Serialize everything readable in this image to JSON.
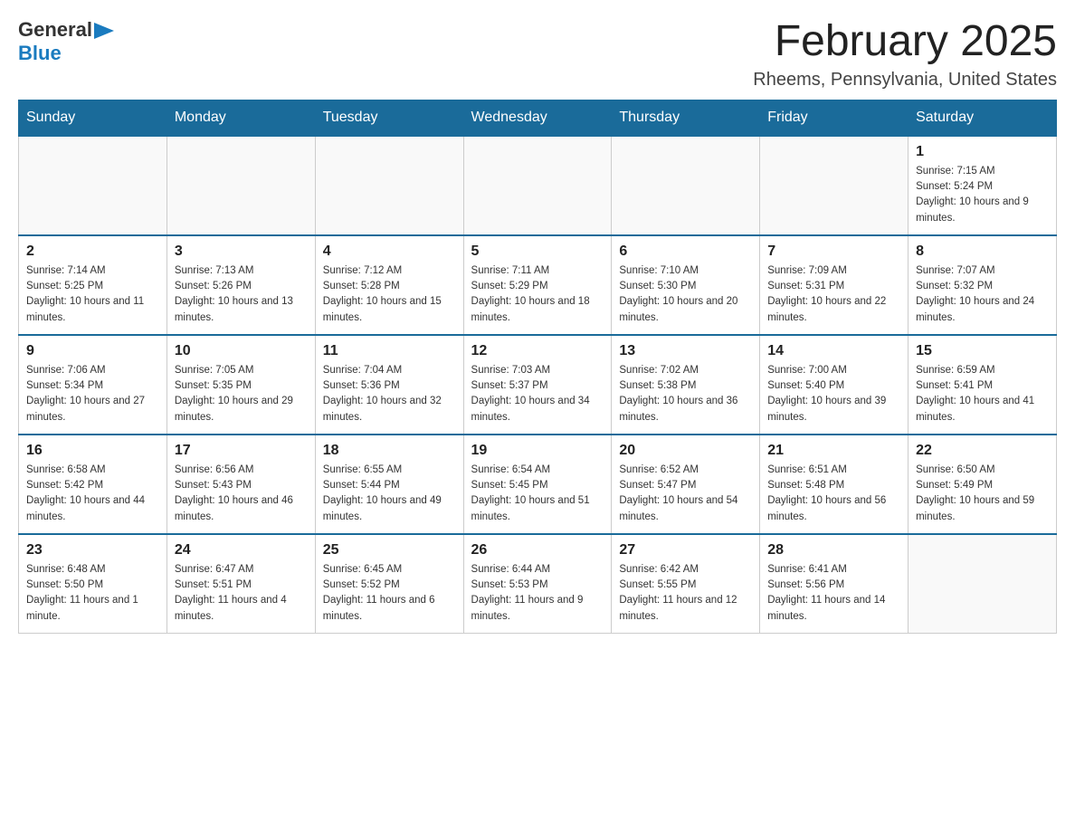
{
  "header": {
    "logo_general": "General",
    "logo_blue": "Blue",
    "title": "February 2025",
    "subtitle": "Rheems, Pennsylvania, United States"
  },
  "days_of_week": [
    "Sunday",
    "Monday",
    "Tuesday",
    "Wednesday",
    "Thursday",
    "Friday",
    "Saturday"
  ],
  "weeks": [
    [
      {
        "day": "",
        "info": ""
      },
      {
        "day": "",
        "info": ""
      },
      {
        "day": "",
        "info": ""
      },
      {
        "day": "",
        "info": ""
      },
      {
        "day": "",
        "info": ""
      },
      {
        "day": "",
        "info": ""
      },
      {
        "day": "1",
        "info": "Sunrise: 7:15 AM\nSunset: 5:24 PM\nDaylight: 10 hours and 9 minutes."
      }
    ],
    [
      {
        "day": "2",
        "info": "Sunrise: 7:14 AM\nSunset: 5:25 PM\nDaylight: 10 hours and 11 minutes."
      },
      {
        "day": "3",
        "info": "Sunrise: 7:13 AM\nSunset: 5:26 PM\nDaylight: 10 hours and 13 minutes."
      },
      {
        "day": "4",
        "info": "Sunrise: 7:12 AM\nSunset: 5:28 PM\nDaylight: 10 hours and 15 minutes."
      },
      {
        "day": "5",
        "info": "Sunrise: 7:11 AM\nSunset: 5:29 PM\nDaylight: 10 hours and 18 minutes."
      },
      {
        "day": "6",
        "info": "Sunrise: 7:10 AM\nSunset: 5:30 PM\nDaylight: 10 hours and 20 minutes."
      },
      {
        "day": "7",
        "info": "Sunrise: 7:09 AM\nSunset: 5:31 PM\nDaylight: 10 hours and 22 minutes."
      },
      {
        "day": "8",
        "info": "Sunrise: 7:07 AM\nSunset: 5:32 PM\nDaylight: 10 hours and 24 minutes."
      }
    ],
    [
      {
        "day": "9",
        "info": "Sunrise: 7:06 AM\nSunset: 5:34 PM\nDaylight: 10 hours and 27 minutes."
      },
      {
        "day": "10",
        "info": "Sunrise: 7:05 AM\nSunset: 5:35 PM\nDaylight: 10 hours and 29 minutes."
      },
      {
        "day": "11",
        "info": "Sunrise: 7:04 AM\nSunset: 5:36 PM\nDaylight: 10 hours and 32 minutes."
      },
      {
        "day": "12",
        "info": "Sunrise: 7:03 AM\nSunset: 5:37 PM\nDaylight: 10 hours and 34 minutes."
      },
      {
        "day": "13",
        "info": "Sunrise: 7:02 AM\nSunset: 5:38 PM\nDaylight: 10 hours and 36 minutes."
      },
      {
        "day": "14",
        "info": "Sunrise: 7:00 AM\nSunset: 5:40 PM\nDaylight: 10 hours and 39 minutes."
      },
      {
        "day": "15",
        "info": "Sunrise: 6:59 AM\nSunset: 5:41 PM\nDaylight: 10 hours and 41 minutes."
      }
    ],
    [
      {
        "day": "16",
        "info": "Sunrise: 6:58 AM\nSunset: 5:42 PM\nDaylight: 10 hours and 44 minutes."
      },
      {
        "day": "17",
        "info": "Sunrise: 6:56 AM\nSunset: 5:43 PM\nDaylight: 10 hours and 46 minutes."
      },
      {
        "day": "18",
        "info": "Sunrise: 6:55 AM\nSunset: 5:44 PM\nDaylight: 10 hours and 49 minutes."
      },
      {
        "day": "19",
        "info": "Sunrise: 6:54 AM\nSunset: 5:45 PM\nDaylight: 10 hours and 51 minutes."
      },
      {
        "day": "20",
        "info": "Sunrise: 6:52 AM\nSunset: 5:47 PM\nDaylight: 10 hours and 54 minutes."
      },
      {
        "day": "21",
        "info": "Sunrise: 6:51 AM\nSunset: 5:48 PM\nDaylight: 10 hours and 56 minutes."
      },
      {
        "day": "22",
        "info": "Sunrise: 6:50 AM\nSunset: 5:49 PM\nDaylight: 10 hours and 59 minutes."
      }
    ],
    [
      {
        "day": "23",
        "info": "Sunrise: 6:48 AM\nSunset: 5:50 PM\nDaylight: 11 hours and 1 minute."
      },
      {
        "day": "24",
        "info": "Sunrise: 6:47 AM\nSunset: 5:51 PM\nDaylight: 11 hours and 4 minutes."
      },
      {
        "day": "25",
        "info": "Sunrise: 6:45 AM\nSunset: 5:52 PM\nDaylight: 11 hours and 6 minutes."
      },
      {
        "day": "26",
        "info": "Sunrise: 6:44 AM\nSunset: 5:53 PM\nDaylight: 11 hours and 9 minutes."
      },
      {
        "day": "27",
        "info": "Sunrise: 6:42 AM\nSunset: 5:55 PM\nDaylight: 11 hours and 12 minutes."
      },
      {
        "day": "28",
        "info": "Sunrise: 6:41 AM\nSunset: 5:56 PM\nDaylight: 11 hours and 14 minutes."
      },
      {
        "day": "",
        "info": ""
      }
    ]
  ]
}
